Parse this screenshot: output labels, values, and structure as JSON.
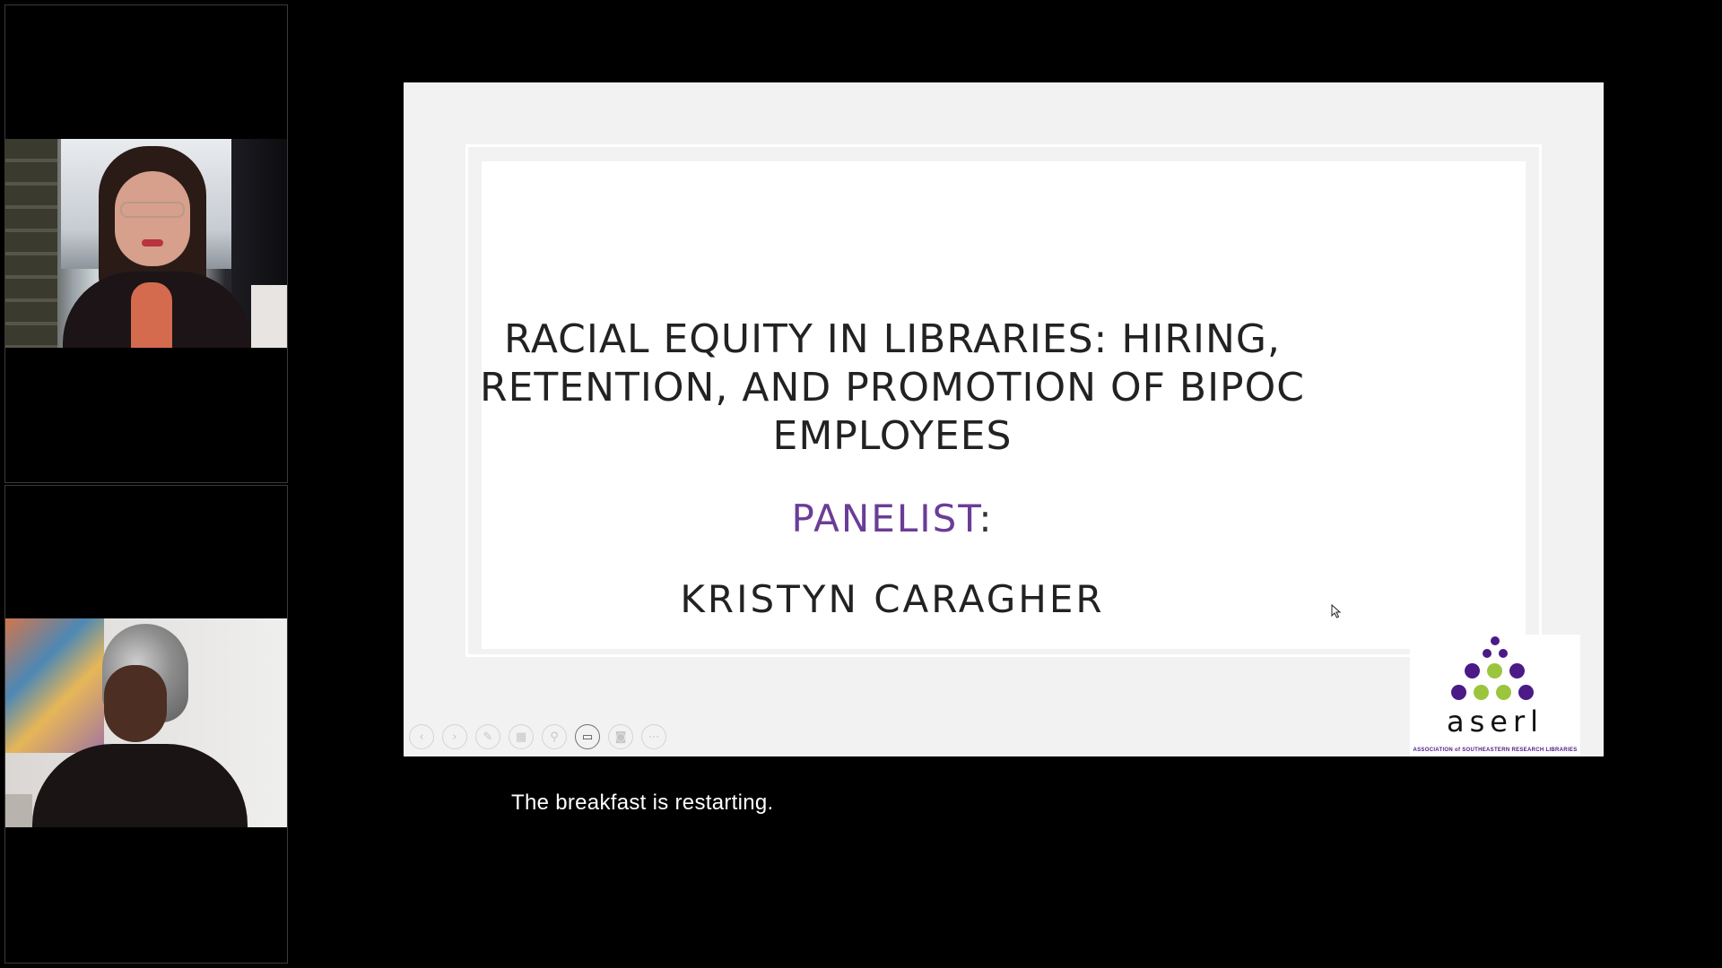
{
  "participants": [
    {
      "name": "participant-1",
      "label": ""
    },
    {
      "name": "participant-2",
      "label": ""
    }
  ],
  "slide": {
    "title_lines": [
      "RACIAL EQUITY IN LIBRARIES: HIRING,",
      "RETENTION, AND PROMOTION OF BIPOC",
      "EMPLOYEES"
    ],
    "panelist_label": "PANELIST",
    "panelist_colon": ":",
    "panelist_name": "KRISTYN CARAGHER",
    "logo": {
      "wordmark": "aserl",
      "tagline": "ASSOCIATION of SOUTHEASTERN RESEARCH LIBRARIES"
    },
    "toolbar": [
      {
        "name": "previous-slide-button",
        "icon": "chevron-left-icon",
        "glyph": "‹"
      },
      {
        "name": "next-slide-button",
        "icon": "chevron-right-icon",
        "glyph": "›"
      },
      {
        "name": "pen-tool-button",
        "icon": "pen-icon",
        "glyph": "✎"
      },
      {
        "name": "see-all-slides-button",
        "icon": "grid-icon",
        "glyph": "▦"
      },
      {
        "name": "zoom-button",
        "icon": "magnifier-icon",
        "glyph": "⚲"
      },
      {
        "name": "subtitles-button",
        "icon": "subtitles-icon",
        "glyph": "▭"
      },
      {
        "name": "camera-button",
        "icon": "camera-icon",
        "glyph": "◙"
      },
      {
        "name": "more-options-button",
        "icon": "ellipsis-icon",
        "glyph": "⋯"
      }
    ]
  },
  "caption": "The breakfast is restarting.",
  "colors": {
    "accent_purple": "#6a3d97",
    "logo_purple": "#4b1a86",
    "logo_green": "#9bc53d",
    "background": "#000000"
  }
}
